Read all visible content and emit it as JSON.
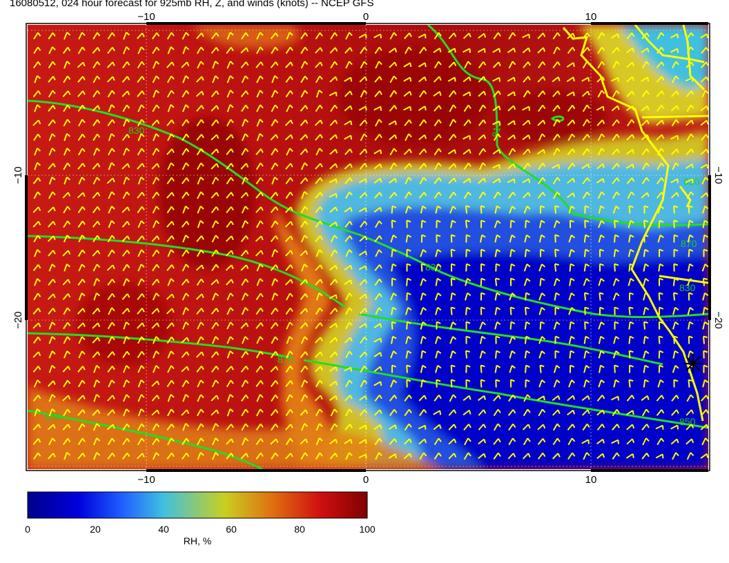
{
  "title": "16080512, 024 hour forecast for 925mb RH, Z, and winds (knots) -- NCEP GFS",
  "map": {
    "lon_range": [
      -15,
      15.5
    ],
    "lat_range": [
      -2,
      -29
    ],
    "lon_ticks": [
      "−10",
      "0",
      "10"
    ],
    "lat_ticks": [
      "−10",
      "−20"
    ],
    "contour_labels": [
      "830",
      "830",
      "870",
      "850",
      "810",
      "830",
      "870",
      "850",
      "830"
    ],
    "marker": "star-icon",
    "fields": [
      "RH",
      "Z",
      "winds"
    ],
    "colors": {
      "coast": "#ffff00",
      "contour": "#22dd22",
      "barb": "#ffff00",
      "grid": "#ffffff"
    }
  },
  "colorbar": {
    "label": "RH, %",
    "ticks": [
      "0",
      "20",
      "40",
      "60",
      "80",
      "100"
    ],
    "stops": [
      "#00008b",
      "#0000dd",
      "#2060ff",
      "#40c0e0",
      "#c8d020",
      "#e07010",
      "#d01010",
      "#800000"
    ]
  }
}
